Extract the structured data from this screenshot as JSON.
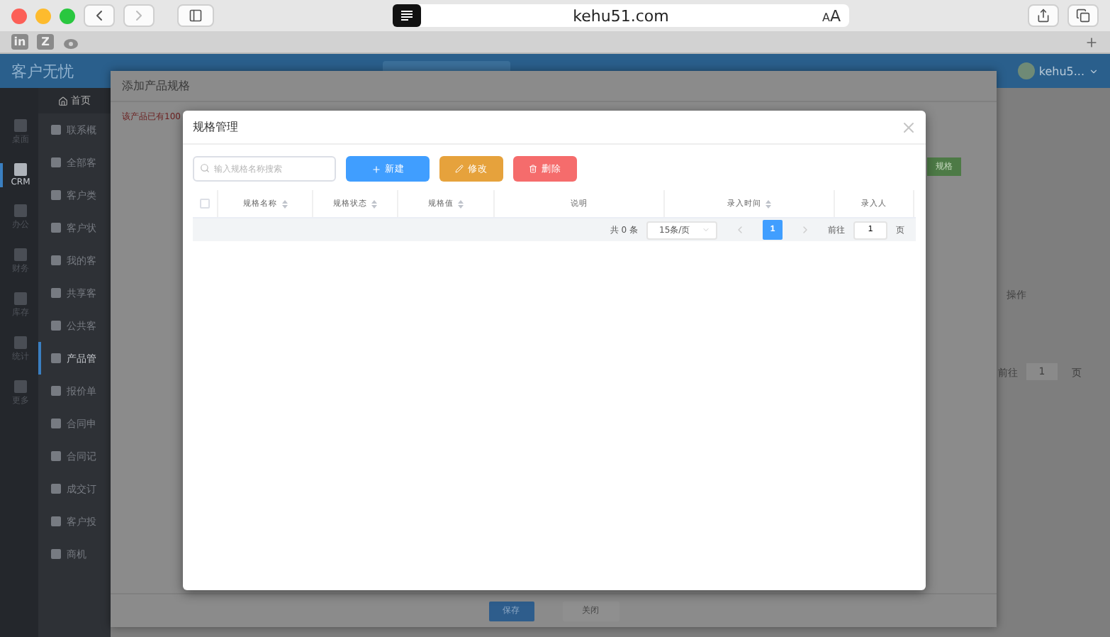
{
  "browser": {
    "address": "kehu51.com",
    "text_size": "AA",
    "bookmarks": [
      {
        "kind": "letter",
        "label": "in"
      },
      {
        "kind": "letter",
        "label": "Z"
      },
      {
        "kind": "weibo"
      }
    ]
  },
  "app": {
    "title": "客户无忧",
    "user": "kehu5...",
    "home": "首页",
    "rail": [
      {
        "label": "桌面",
        "selected": false
      },
      {
        "label": "CRM",
        "selected": true
      },
      {
        "label": "办公",
        "selected": false
      },
      {
        "label": "财务",
        "selected": false
      },
      {
        "label": "库存",
        "selected": false
      },
      {
        "label": "统计",
        "selected": false
      },
      {
        "label": "更多",
        "selected": false
      }
    ],
    "menu": [
      {
        "label": "联系概",
        "selected": false
      },
      {
        "label": "全部客",
        "selected": false
      },
      {
        "label": "客户类",
        "selected": false
      },
      {
        "label": "客户状",
        "selected": false
      },
      {
        "label": "我的客",
        "selected": false
      },
      {
        "label": "共享客",
        "selected": false
      },
      {
        "label": "公共客",
        "selected": false
      },
      {
        "label": "产品管",
        "selected": true
      },
      {
        "label": "报价单",
        "selected": false
      },
      {
        "label": "合同申",
        "selected": false
      },
      {
        "label": "合同记",
        "selected": false
      },
      {
        "label": "成交订",
        "selected": false
      },
      {
        "label": "客户投",
        "selected": false
      },
      {
        "label": "商机",
        "selected": false
      }
    ],
    "background": {
      "green_button": "规格",
      "column_label": "操作",
      "goto_label": "前往",
      "goto_value": "1",
      "goto_suffix": "页"
    }
  },
  "outer_dialog": {
    "title": "添加产品规格",
    "notice": "该产品已有100",
    "buttons": [
      {
        "label": "保存",
        "kind": "primary"
      },
      {
        "label": "关闭",
        "kind": "plain"
      }
    ]
  },
  "modal": {
    "title": "规格管理",
    "search": {
      "placeholder": "输入规格名称搜索"
    },
    "buttons": [
      {
        "label": "新建",
        "kind": "create"
      },
      {
        "label": "修改",
        "kind": "edit"
      },
      {
        "label": "删除",
        "kind": "delete"
      }
    ],
    "select_all": {
      "checked": false
    },
    "columns": [
      {
        "label": "规格名称",
        "sortable": true
      },
      {
        "label": "规格状态",
        "sortable": true
      },
      {
        "label": "规格值",
        "sortable": true
      },
      {
        "label": "说明",
        "sortable": false
      },
      {
        "label": "录入时间",
        "sortable": true
      },
      {
        "label": "录入人",
        "sortable": false
      }
    ],
    "pagination": {
      "total": "共 0 条",
      "page_size": "15条/页",
      "pages": [
        {
          "label": "1",
          "selected": true
        }
      ],
      "goto_label": "前往",
      "goto_value": "1",
      "goto_suffix": "页"
    }
  }
}
